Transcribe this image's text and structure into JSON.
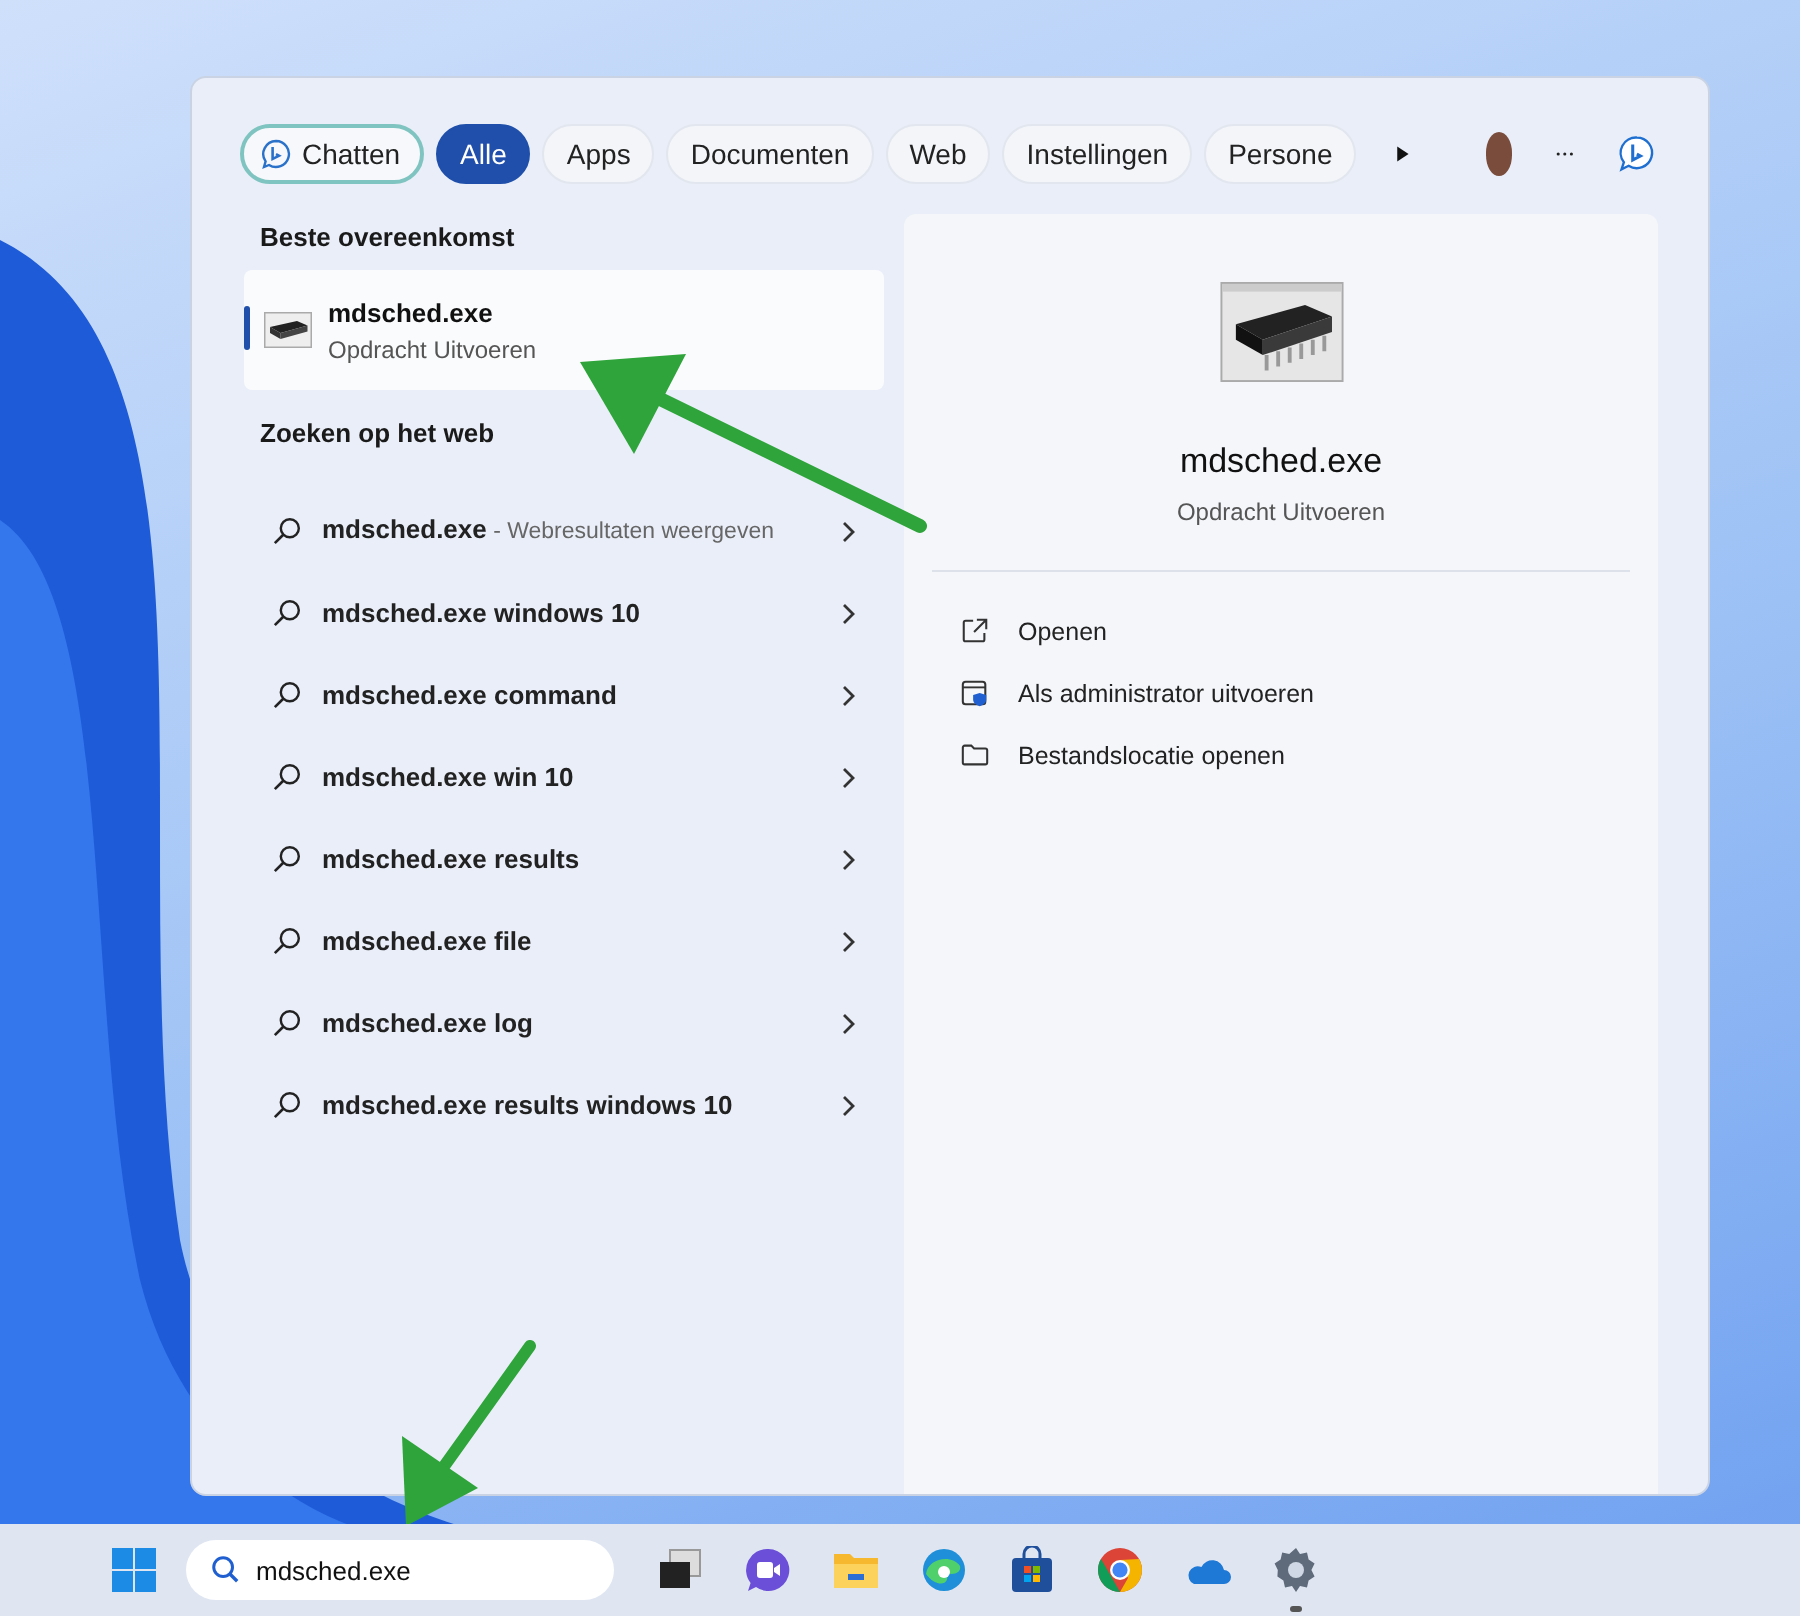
{
  "tabs": [
    {
      "kind": "chat",
      "label": "Chatten",
      "selected": false
    },
    {
      "kind": "filter",
      "label": "Alle",
      "selected": true
    },
    {
      "kind": "filter",
      "label": "Apps",
      "selected": false
    },
    {
      "kind": "filter",
      "label": "Documenten",
      "selected": false
    },
    {
      "kind": "filter",
      "label": "Web",
      "selected": false
    },
    {
      "kind": "filter",
      "label": "Instellingen",
      "selected": false
    },
    {
      "kind": "filter",
      "label": "Persone",
      "selected": false
    }
  ],
  "best_match": {
    "heading": "Beste overeenkomst",
    "title": "mdsched.exe",
    "subtitle": "Opdracht Uitvoeren",
    "selected": true
  },
  "web": {
    "heading": "Zoeken op het web",
    "results": [
      {
        "query": "mdsched.exe",
        "detail": " - Webresultaten weergeven"
      },
      {
        "query": "mdsched.exe windows 10"
      },
      {
        "query": "mdsched.exe command"
      },
      {
        "query": "mdsched.exe win 10"
      },
      {
        "query": "mdsched.exe results"
      },
      {
        "query": "mdsched.exe file"
      },
      {
        "query": "mdsched.exe log"
      },
      {
        "query": "mdsched.exe results windows 10"
      }
    ]
  },
  "preview": {
    "title": "mdsched.exe",
    "subtitle": "Opdracht Uitvoeren",
    "actions": [
      {
        "kind": "open",
        "label": "Openen"
      },
      {
        "kind": "admin",
        "label": "Als administrator uitvoeren"
      },
      {
        "kind": "folder",
        "label": "Bestandslocatie openen"
      }
    ]
  },
  "taskbar": {
    "search_value": "mdsched.exe",
    "apps": [
      {
        "kind": "taskview",
        "running": false
      },
      {
        "kind": "chat",
        "running": false
      },
      {
        "kind": "explorer",
        "running": false
      },
      {
        "kind": "edge",
        "running": false
      },
      {
        "kind": "store",
        "running": false
      },
      {
        "kind": "chrome",
        "running": false
      },
      {
        "kind": "onedrive",
        "running": false
      },
      {
        "kind": "settings",
        "running": true
      }
    ]
  }
}
